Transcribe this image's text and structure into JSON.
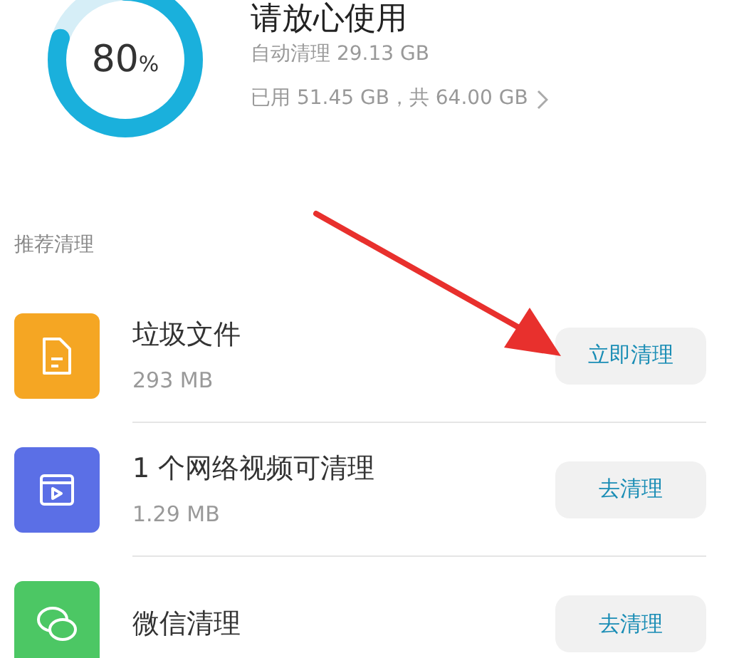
{
  "storage": {
    "level": 0.8,
    "percent": "80",
    "percent_unit": "%",
    "title": "请放心使用",
    "auto_clean": "自动清理 29.13 GB",
    "usage": "已用 51.45 GB，共 64.00 GB"
  },
  "section_title": "推荐清理",
  "items": [
    {
      "kind": "file",
      "color": "#f5a623",
      "title": "垃圾文件",
      "size": "293 MB",
      "button": "立即清理"
    },
    {
      "kind": "video",
      "color": "#5b6fe6",
      "title": "1 个网络视频可清理",
      "size": "1.29 MB",
      "button": "去清理"
    },
    {
      "kind": "chat",
      "color": "#4cc764",
      "title": "微信清理",
      "button": "去清理"
    }
  ]
}
